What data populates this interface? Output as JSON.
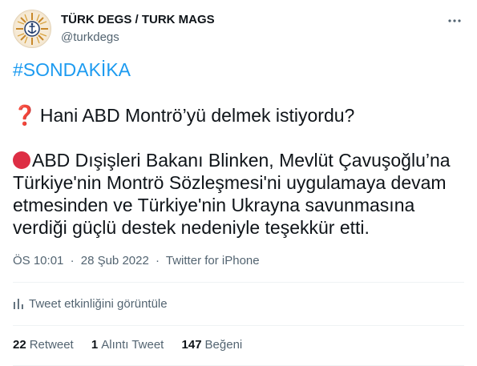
{
  "author": {
    "display_name": "TÜRK DEGS / TURK MAGS",
    "handle": "@turkdegs",
    "avatar_icon": "compass-anchor-logo-icon",
    "more_icon": "more-options-icon"
  },
  "tweet": {
    "hashtag": "#SONDAKİKA",
    "question_icon": "red-question-mark-icon",
    "question_text": "Hani ABD Montrö’yü delmek istiyordu?",
    "bullet_icon": "red-circle-icon",
    "body_lines": [
      "ABD Dışişleri Bakanı Blinken, Mevlüt Çavuşoğlu’na",
      "Türkiye'nin Montrö Sözleşmesi'ni uygulamaya devam",
      "etmesinden ve Türkiye'nin Ukrayna savunmasına",
      "verdiği güçlü destek nedeniyle teşekkür etti."
    ]
  },
  "meta": {
    "time": "ÖS 10:01",
    "date": "28 Şub 2022",
    "separator": "·",
    "source": "Twitter for iPhone"
  },
  "activity": {
    "icon": "bar-chart-icon",
    "label": "Tweet etkinliğini görüntüle"
  },
  "stats": [
    {
      "count": "22",
      "label": "Retweet"
    },
    {
      "count": "1",
      "label": "Alıntı Tweet"
    },
    {
      "count": "147",
      "label": "Beğeni"
    }
  ],
  "colors": {
    "link": "#1d9bf0",
    "text": "#0f1419",
    "secondary": "#536471",
    "red_circle": "#dd2e44",
    "divider": "#eff3f4"
  }
}
